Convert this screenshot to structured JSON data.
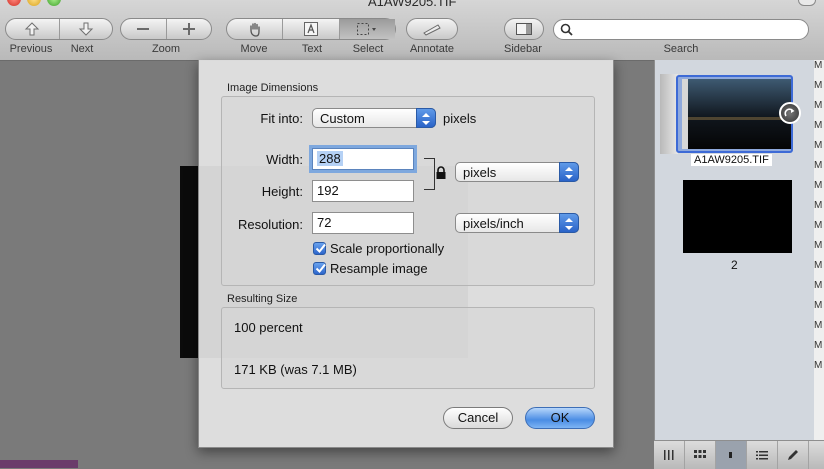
{
  "window": {
    "title": "A1AW9205.TIF"
  },
  "toolbar": {
    "previous": "Previous",
    "next": "Next",
    "zoom": "Zoom",
    "move": "Move",
    "text": "Text",
    "select": "Select",
    "annotate": "Annotate",
    "sidebar": "Sidebar",
    "search": "Search",
    "search_value": ""
  },
  "dialog": {
    "section_dimensions": "Image Dimensions",
    "fit_into_label": "Fit into:",
    "fit_into_value": "Custom",
    "fit_into_unit": "pixels",
    "width_label": "Width:",
    "width_value": "288",
    "height_label": "Height:",
    "height_value": "192",
    "size_unit": "pixels",
    "resolution_label": "Resolution:",
    "resolution_value": "72",
    "resolution_unit": "pixels/inch",
    "scale_label": "Scale proportionally",
    "scale_checked": true,
    "resample_label": "Resample image",
    "resample_checked": true,
    "section_result": "Resulting Size",
    "result_percent": "100 percent",
    "result_size": "171 KB (was 7.1 MB)",
    "cancel": "Cancel",
    "ok": "OK"
  },
  "sidebar": {
    "thumbs": [
      {
        "label": "A1AW9205.TIF",
        "selected": true
      },
      {
        "label": "2",
        "selected": false
      }
    ],
    "edge_letters": [
      "M",
      "M",
      "M",
      "M",
      "M",
      "M",
      "M",
      "M",
      "M",
      "M",
      "M",
      "M",
      "M",
      "M",
      "M",
      "M"
    ]
  },
  "colors": {
    "accent": "#3d6ad6",
    "default_button": "#4b8de4"
  }
}
